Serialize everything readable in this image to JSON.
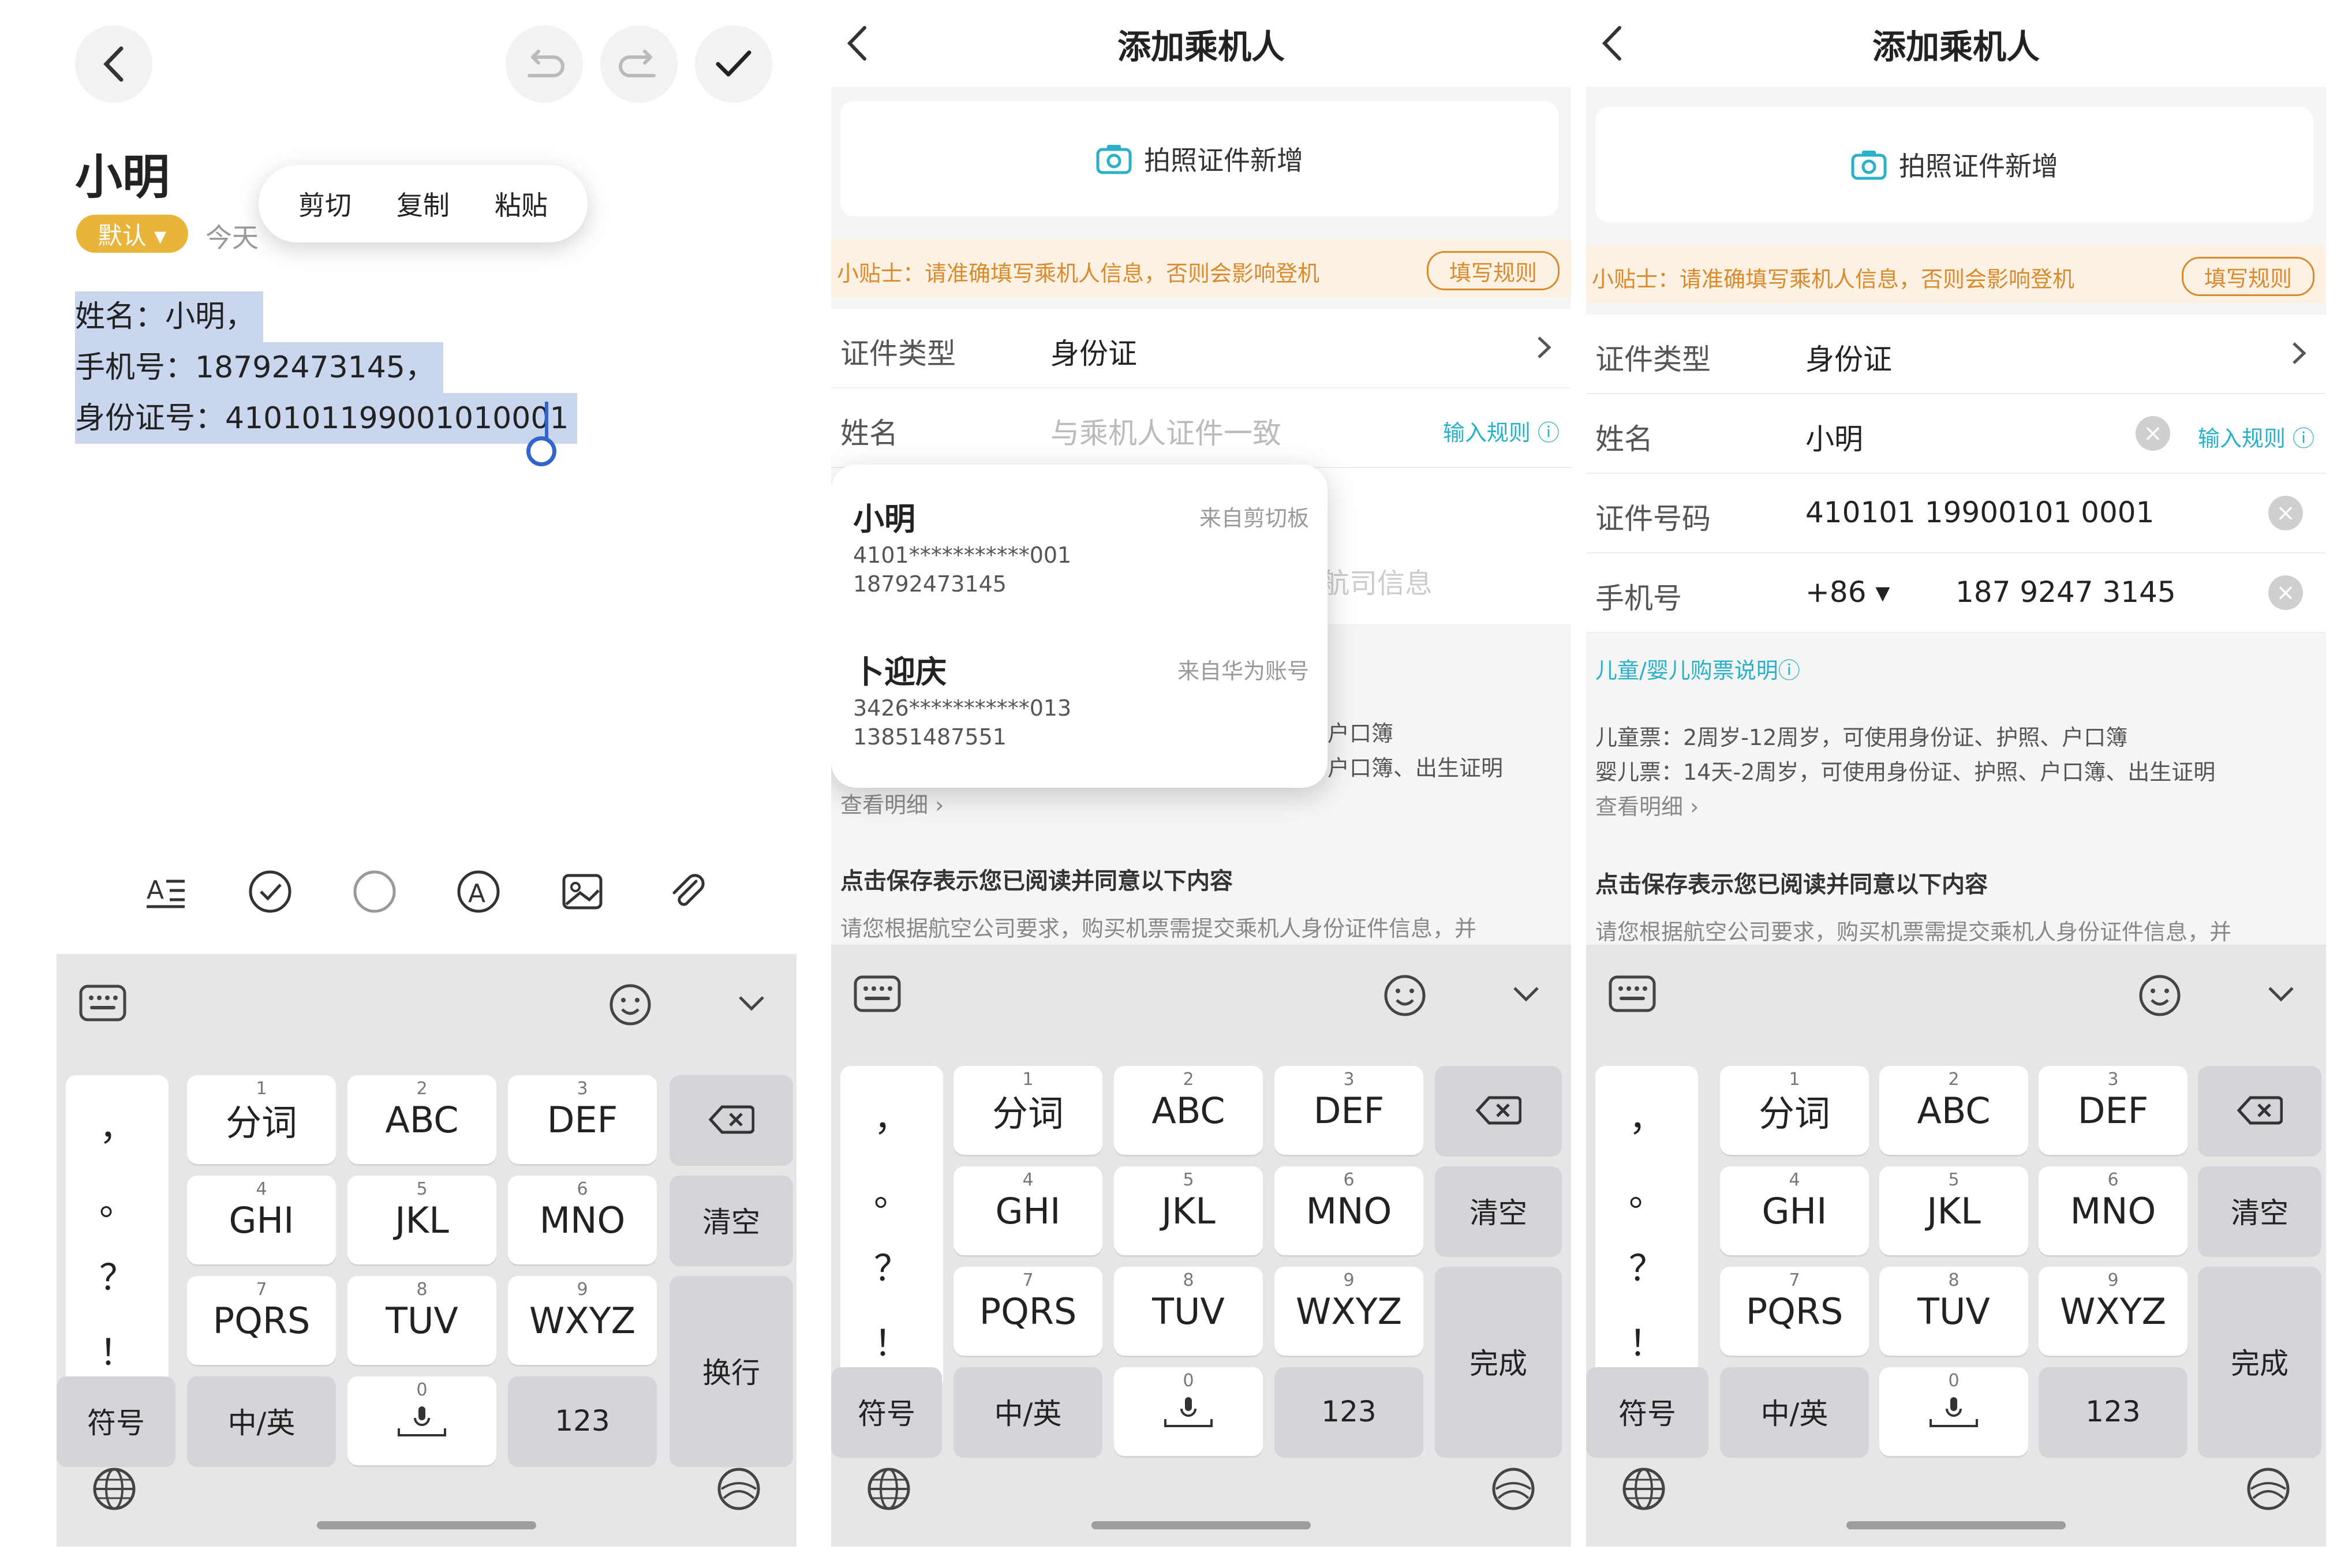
{
  "panel1": {
    "title": "小明",
    "tag": "默认 ▾",
    "date": "今天",
    "context_menu": [
      "剪切",
      "复制",
      "粘贴"
    ],
    "lines": [
      "姓名：小明，",
      "手机号：18792473145，",
      "身份证号：410101199001010001"
    ]
  },
  "panel2": {
    "title": "添加乘机人",
    "photo_button": "拍照证件新增",
    "tip": "小贴士：请准确填写乘机人信息，否则会影响登机",
    "tip_rules": "填写规则",
    "doc_type_label": "证件类型",
    "doc_type_value": "身份证",
    "name_label": "姓名",
    "name_placeholder": "与乘机人证件一致",
    "input_rules": "输入规则 ⓘ",
    "behind_airline": "航司信息",
    "behind_l1": "户口簿",
    "behind_l2": "户口簿、出生证明",
    "more": "查看明细 ›",
    "agree": "点击保存表示您已阅读并同意以下内容",
    "agree_body": "请您根据航空公司要求，购买机票需提交乘机人身份证件信息，并",
    "popup": [
      {
        "name": "小明",
        "source": "来自剪切板",
        "id": "4101***********001",
        "phone": "18792473145"
      },
      {
        "name": "卜迎庆",
        "source": "来自华为账号",
        "id": "3426***********013",
        "phone": "13851487551"
      }
    ]
  },
  "panel3": {
    "title": "添加乘机人",
    "photo_button": "拍照证件新增",
    "tip": "小贴士：请准确填写乘机人信息，否则会影响登机",
    "tip_rules": "填写规则",
    "doc_type_label": "证件类型",
    "doc_type_value": "身份证",
    "name_label": "姓名",
    "name_value": "小明",
    "input_rules": "输入规则 ⓘ",
    "id_label": "证件号码",
    "id_value": "410101 19900101 0001",
    "phone_label": "手机号",
    "phone_code": "+86 ▾",
    "phone_value": "187 9247 3145",
    "child_head": "儿童/婴儿购票说明ⓘ",
    "child_l1": "儿童票：2周岁-12周岁，可使用身份证、护照、户口簿",
    "child_l2": "婴儿票：14天-2周岁，可使用身份证、护照、户口簿、出生证明",
    "more": "查看明细 ›",
    "agree": "点击保存表示您已阅读并同意以下内容",
    "agree_body": "请您根据航空公司要求，购买机票需提交乘机人身份证件信息，并"
  },
  "keyboard": {
    "punct": [
      "，",
      "。",
      "？",
      "！"
    ],
    "row1": [
      {
        "num": "1",
        "label": "分词"
      },
      {
        "num": "2",
        "label": "ABC"
      },
      {
        "num": "3",
        "label": "DEF"
      }
    ],
    "row2": [
      {
        "num": "4",
        "label": "GHI"
      },
      {
        "num": "5",
        "label": "JKL"
      },
      {
        "num": "6",
        "label": "MNO"
      }
    ],
    "row3": [
      {
        "num": "7",
        "label": "PQRS"
      },
      {
        "num": "8",
        "label": "TUV"
      },
      {
        "num": "9",
        "label": "WXYZ"
      }
    ],
    "symbols": "符号",
    "lang": "中/英",
    "space_num": "0",
    "num_key": "123",
    "clear": "清空",
    "newline": "换行",
    "done": "完成"
  }
}
